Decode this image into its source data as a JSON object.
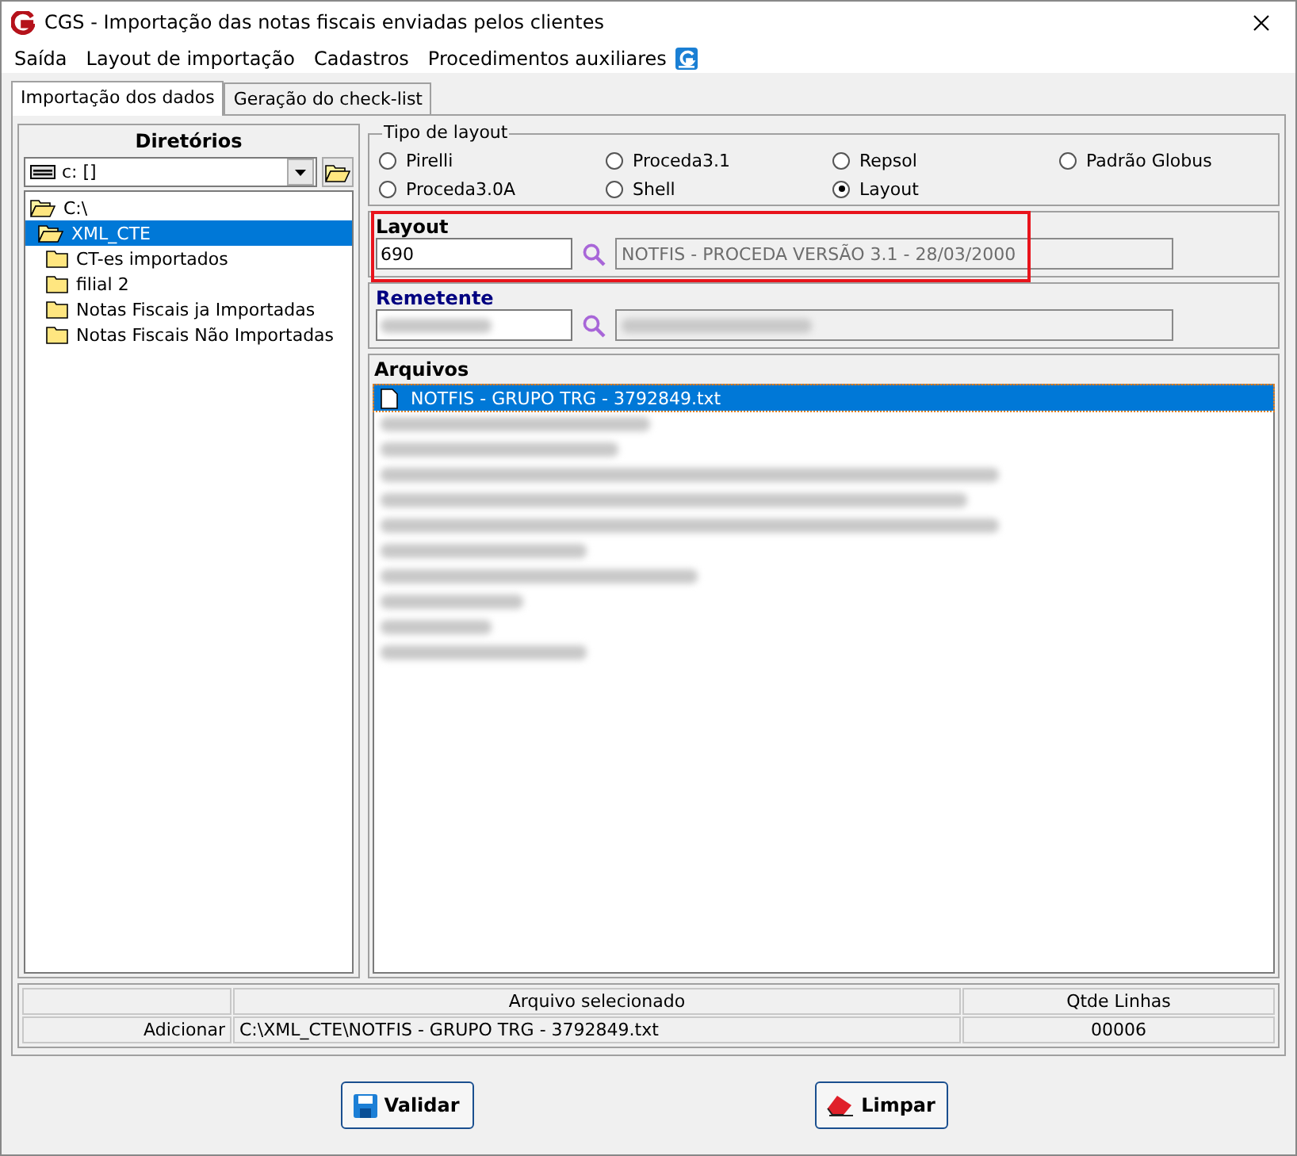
{
  "window": {
    "title": "CGS - Importação das notas fiscais enviadas pelos clientes"
  },
  "menu": [
    "Saída",
    "Layout de importação",
    "Cadastros",
    "Procedimentos auxiliares"
  ],
  "tabs": [
    {
      "label": "Importação dos dados",
      "selected": true
    },
    {
      "label": "Geração do check-list",
      "selected": false
    }
  ],
  "directories": {
    "title": "Diretórios",
    "drive": "c: []",
    "tree": [
      {
        "name": "C:\\",
        "selected": false,
        "expanded": true,
        "children": [
          {
            "name": "XML_CTE",
            "selected": true,
            "expanded": true,
            "children": [
              {
                "name": "CT-es importados",
                "selected": false,
                "expanded": false
              },
              {
                "name": "filial 2",
                "selected": false,
                "expanded": false
              },
              {
                "name": "Notas Fiscais ja Importadas",
                "selected": false,
                "expanded": false
              },
              {
                "name": "Notas Fiscais Não Importadas",
                "selected": false,
                "expanded": false
              }
            ]
          }
        ]
      }
    ]
  },
  "layout_type": {
    "title": "Tipo de layout",
    "options": [
      {
        "label": "Pirelli",
        "selected": false
      },
      {
        "label": "Proceda3.1",
        "selected": false
      },
      {
        "label": "Repsol",
        "selected": false
      },
      {
        "label": "Padrão Globus",
        "selected": false
      },
      {
        "label": "Proceda3.0A",
        "selected": false
      },
      {
        "label": "Shell",
        "selected": false
      },
      {
        "label": "Layout",
        "selected": true
      }
    ]
  },
  "layout": {
    "label": "Layout",
    "code": "690",
    "description": "NOTFIS - PROCEDA VERSÃO 3.1 - 28/03/2000",
    "highlighted": true
  },
  "remetente": {
    "label": "Remetente",
    "blurred": true
  },
  "files": {
    "title": "Arquivos",
    "items": [
      {
        "kind": "file",
        "name": "NOTFIS - GRUPO TRG - 3792849.txt",
        "selected": true
      },
      {
        "kind": "blurred",
        "selected": false
      },
      {
        "kind": "blurred",
        "selected": false
      },
      {
        "kind": "blurred",
        "selected": false
      },
      {
        "kind": "blurred",
        "selected": false
      },
      {
        "kind": "blurred",
        "selected": false
      },
      {
        "kind": "blurred",
        "selected": false
      },
      {
        "kind": "blurred",
        "selected": false
      },
      {
        "kind": "blurred",
        "selected": false
      },
      {
        "kind": "blurred",
        "selected": false
      },
      {
        "kind": "blurred",
        "selected": false
      }
    ]
  },
  "status": {
    "columns": [
      "Arquivo selecionado",
      "Qtde Linhas"
    ],
    "action": "Adicionar",
    "path": "C:\\XML_CTE\\NOTFIS - GRUPO TRG - 3792849.txt",
    "lines": "00006"
  },
  "buttons": [
    {
      "kind": "save",
      "label": "Validar"
    },
    {
      "kind": "erase",
      "label": "Limpar"
    }
  ]
}
